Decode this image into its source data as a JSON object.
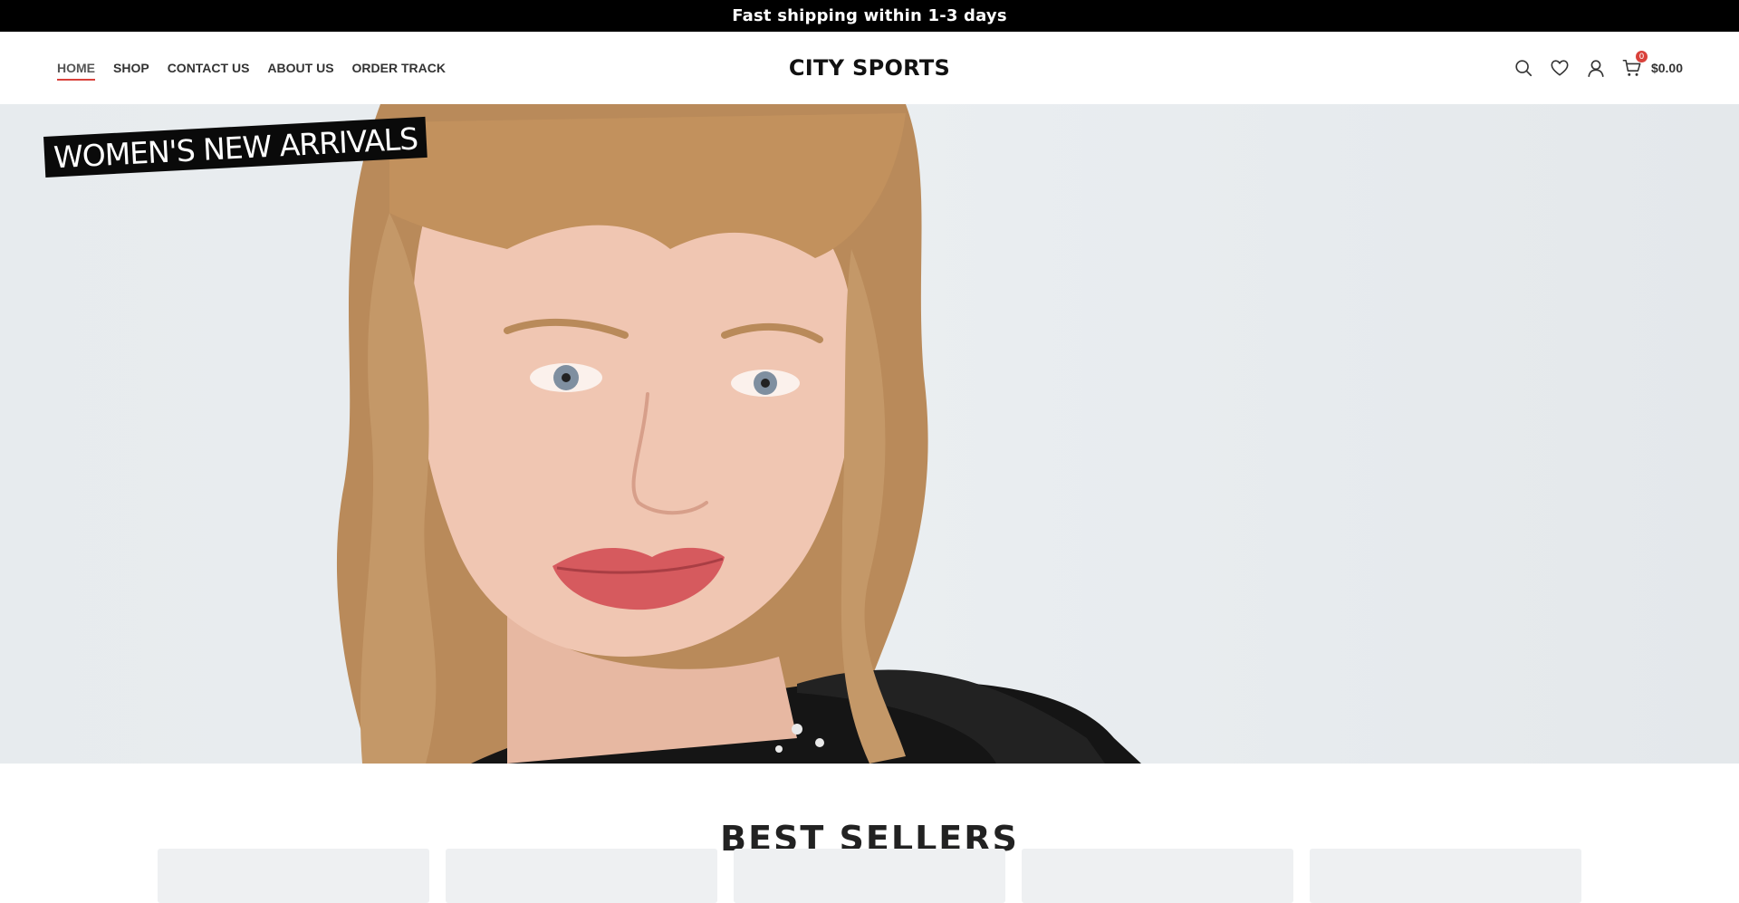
{
  "topbar": {
    "text": "Fast shipping within 1-3 days"
  },
  "header": {
    "nav": [
      {
        "label": "HOME",
        "active": true
      },
      {
        "label": "SHOP"
      },
      {
        "label": "CONTACT US"
      },
      {
        "label": "ABOUT US"
      },
      {
        "label": "ORDER TRACK"
      }
    ],
    "brand": "CITY SPORTS",
    "icons": [
      "search-icon",
      "heart-icon",
      "user-icon",
      "cart-icon"
    ],
    "cart": {
      "count": "0",
      "total": "$0.00"
    }
  },
  "hero": {
    "tag": "WOMEN'S NEW ARRIVALS"
  },
  "best_sellers": {
    "title": "BEST SELLERS",
    "card_count": 5
  },
  "colors": {
    "accent": "#d9413b",
    "topbar_bg": "#000000"
  }
}
